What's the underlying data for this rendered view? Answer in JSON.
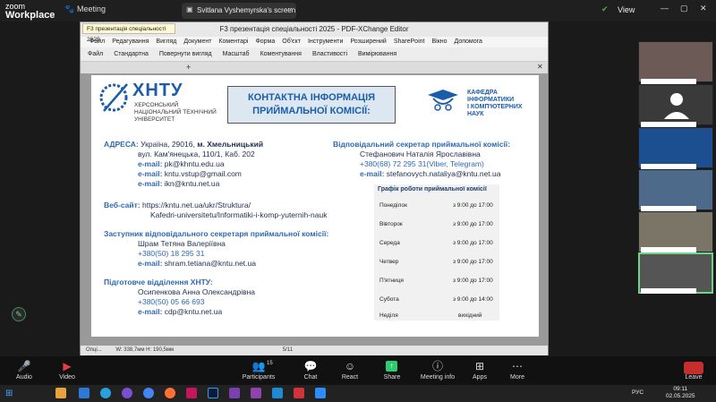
{
  "zoom": {
    "logo_line1": "zoom",
    "logo_line2": "Workplace",
    "meeting_label": "Meeting",
    "share_label": "Svitlana Vyshemyrska's screen",
    "view_label": "View"
  },
  "pdf": {
    "window_title": "F3 презентація спеціальності 2025 - PDF-XChange Editor",
    "menu": [
      "Файл",
      "Редагування",
      "Вигляд",
      "Документ",
      "Коментарі",
      "Форма",
      "Об'єкт",
      "Інструменти",
      "Розширений",
      "SharePoint",
      "Вікно",
      "Допомога"
    ],
    "toolbar": [
      "Файл",
      "Стандартна",
      "Повернути вигляд",
      "Масштаб",
      "Коментування",
      "Властивості",
      "Вимірювання"
    ],
    "tab_label": "F3 презентація спеціальності 2025",
    "status_left": "Опці...",
    "status_dims": "W: 338,7мм  H: 190,5мм",
    "page_indicator": "5/11"
  },
  "slide": {
    "logo_text": "ХНТУ",
    "uni_lines": [
      "ХЕРСОНСЬКИЙ",
      "НАЦІОНАЛЬНИЙ ТЕХНІЧНИЙ",
      "УНІВЕРСИТЕТ"
    ],
    "heading": "КОНТАКТНА ІНФОРМАЦІЯ ПРИЙМАЛЬНОЇ КОМІСІЇ:",
    "dept_lines": [
      "КАФЕДРА",
      "ІНФОРМАТИКИ",
      "І КОМП'ЮТЕРНИХ",
      "НАУК"
    ],
    "address_label": "АДРЕСА:",
    "address_text": "Україна, 29016,",
    "address_city": "м. Хмельницький",
    "address_line2": "вул. Кам'янецька, 110/1, Каб. 202",
    "emails": [
      {
        "label": "e-mail:",
        "value": "pk@khntu.edu.ua"
      },
      {
        "label": "e-mail:",
        "value": "kntu.vstup@gmail.com"
      },
      {
        "label": "e-mail:",
        "value": "ikn@kntu.net.ua"
      }
    ],
    "site_label": "Веб-сайт:",
    "site_line1": "https://kntu.net.ua/ukr/Struktura/",
    "site_line2": "Kafedri-universitetu/Informatiki-i-komp-yuternih-nauk",
    "deputy_title": "Заступник відповідального секретаря приймальної комісії:",
    "deputy_name": "Шрам Тетяна Валеріївна",
    "deputy_phone": "+380(50) 18 295 31",
    "deputy_email_label": "e-mail:",
    "deputy_email": "shram.tetiana@kntu.net.ua",
    "prep_title": "Підготовче відділення ХНТУ:",
    "prep_name": "Осипенкова Анна Олександрівна",
    "prep_phone": "+380(50) 05 66 693",
    "prep_email_label": "e-mail:",
    "prep_email": "cdp@kntu.net.ua",
    "secretary_title": "Відповідальний секретар приймальної комісії:",
    "secretary_name": "Стефанович Наталія Ярославівна",
    "secretary_phone": "+380(68) 72 295 31(Viber, Telegram)",
    "secretary_email_label": "e-mail:",
    "secretary_email": "stefanovych.nataliya@kntu.net.ua",
    "schedule_title": "Графік роботи приймальної комісії",
    "schedule": [
      {
        "day": "Понеділок",
        "time": "з 9:00 до 17:00"
      },
      {
        "day": "Вівторок",
        "time": "з 9:00 до 17:00"
      },
      {
        "day": "Середа",
        "time": "з 9:00 до 17:00"
      },
      {
        "day": "Четвер",
        "time": "з 9:00 до 17:00"
      },
      {
        "day": "П'ятниця",
        "time": "з 9:00 до 17:00"
      },
      {
        "day": "Субота",
        "time": "з 9:00 до 14:00"
      },
      {
        "day": "Неділя",
        "time": "вихідний"
      }
    ]
  },
  "controls": {
    "audio": "Audio",
    "video": "Video",
    "participants": "Participants",
    "participants_count": "15",
    "chat": "Chat",
    "react": "React",
    "share": "Share",
    "meeting_info": "Meeting info",
    "apps": "Apps",
    "more": "More",
    "leave": "Leave"
  },
  "taskbar": {
    "lang": "РУС",
    "time": "09:11",
    "date": "02.05.2025"
  },
  "colors": {
    "accent": "#1b5da8",
    "leave": "#c62d2d",
    "share": "#2ecc71",
    "active_tile": "#6fd38b"
  }
}
